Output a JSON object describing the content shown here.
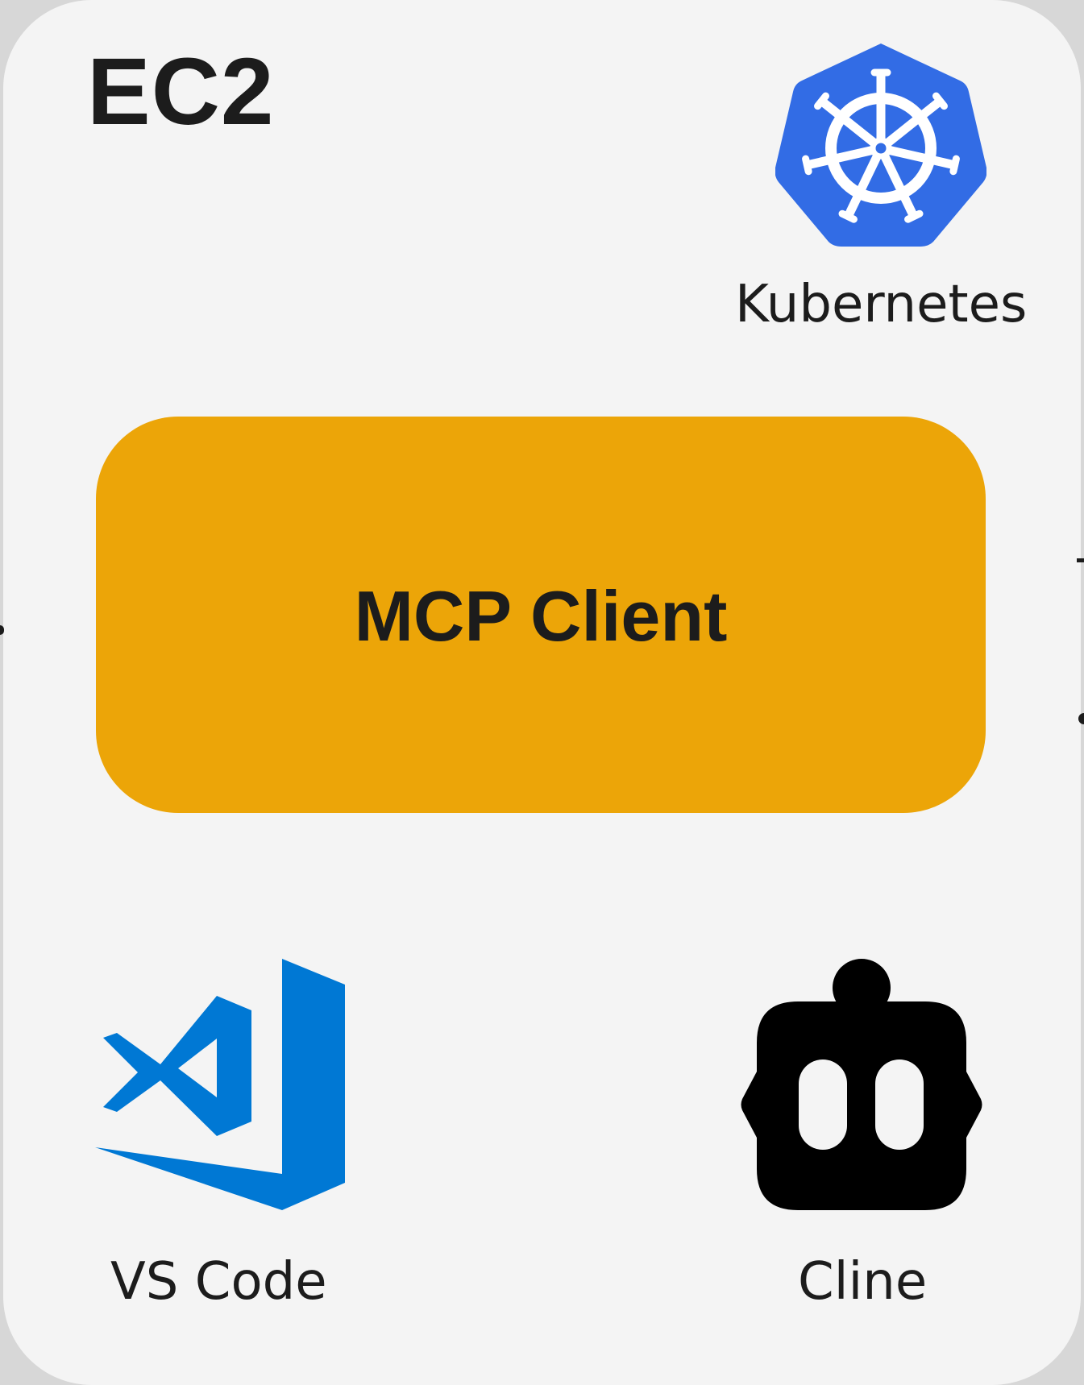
{
  "diagram": {
    "container_title": "EC2",
    "main_box": {
      "label": "MCP Client",
      "color": "#eca508"
    },
    "components": {
      "kubernetes": {
        "label": "Kubernetes",
        "icon": "kubernetes-icon",
        "color": "#326ce5"
      },
      "vscode": {
        "label": "VS Code",
        "icon": "vscode-icon",
        "color": "#0078d4"
      },
      "cline": {
        "label": "Cline",
        "icon": "cline-robot-icon",
        "color": "#000000"
      }
    },
    "colors": {
      "card_background": "#f4f4f4",
      "page_background": "#d7d7d7",
      "text": "#1c1c1c"
    }
  }
}
